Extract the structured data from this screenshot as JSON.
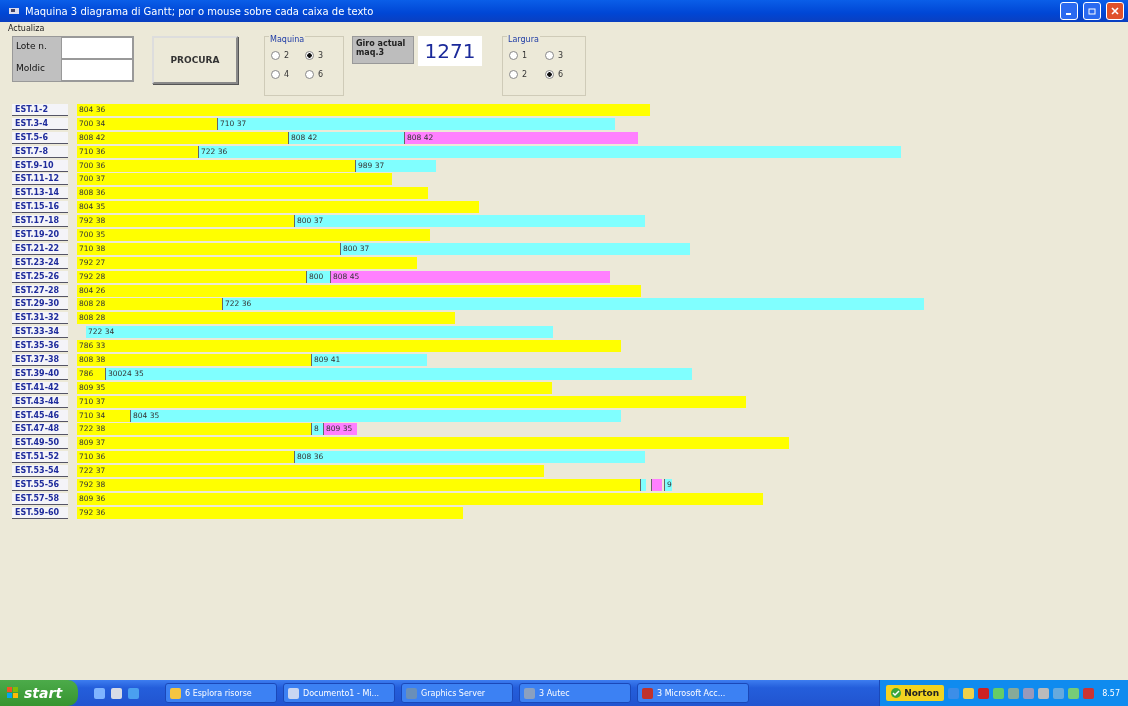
{
  "window": {
    "title": "Maquina 3 diagrama di Gantt; por o mouse sobre cada caixa de texto"
  },
  "menu": [
    "Actualiza"
  ],
  "search": {
    "fields": [
      {
        "label": "Lote n."
      },
      {
        "label": "Moldic"
      }
    ],
    "button": "PROCURA"
  },
  "machine_group": {
    "title": "Maquina",
    "options": [
      {
        "label": "2",
        "selected": false
      },
      {
        "label": "3",
        "selected": true
      },
      {
        "label": "4",
        "selected": false
      },
      {
        "label": "6",
        "selected": false
      }
    ]
  },
  "current_turn": {
    "label": "Giro actual maq.3",
    "value": "1271"
  },
  "width_group": {
    "title": "Largura",
    "options": [
      {
        "label": "1",
        "selected": false
      },
      {
        "label": "3",
        "selected": false
      },
      {
        "label": "2",
        "selected": false
      },
      {
        "label": "6",
        "selected": true
      }
    ]
  },
  "rows": [
    {
      "label": "EST.1-2",
      "segments": [
        {
          "text": "804 36",
          "color": "#ffff00"
        }
      ]
    },
    {
      "label": "EST.3-4",
      "segments": [
        {
          "text": "700 34",
          "color": "#ffff00"
        },
        {
          "text": "710 37",
          "color": "#80ffff"
        }
      ]
    },
    {
      "label": "EST.5-6",
      "segments": [
        {
          "text": "808 42",
          "color": "#ffff00"
        },
        {
          "text": "808 42",
          "color": "#80ffff"
        },
        {
          "text": "808 42",
          "color": "#ff80ff"
        }
      ]
    },
    {
      "label": "EST.7-8",
      "segments": [
        {
          "text": "710 36",
          "color": "#ffff00"
        },
        {
          "text": "722 36",
          "color": "#80ffff"
        }
      ]
    },
    {
      "label": "EST.9-10",
      "segments": [
        {
          "text": "700 36",
          "color": "#ffff00"
        },
        {
          "text": "989 37",
          "color": "#80ffff"
        }
      ]
    },
    {
      "label": "EST.11-12",
      "segments": [
        {
          "text": "700 37",
          "color": "#ffff00"
        }
      ]
    },
    {
      "label": "EST.13-14",
      "segments": [
        {
          "text": "808 36",
          "color": "#ffff00"
        }
      ]
    },
    {
      "label": "EST.15-16",
      "segments": [
        {
          "text": "804 35",
          "color": "#ffff00"
        }
      ]
    },
    {
      "label": "EST.17-18",
      "segments": [
        {
          "text": "792 38",
          "color": "#ffff00"
        },
        {
          "text": "800 37",
          "color": "#80ffff"
        }
      ]
    },
    {
      "label": "EST.19-20",
      "segments": [
        {
          "text": "700 35",
          "color": "#ffff00"
        }
      ]
    },
    {
      "label": "EST.21-22",
      "segments": [
        {
          "text": "710 38",
          "color": "#ffff00"
        },
        {
          "text": "800 37",
          "color": "#80ffff"
        }
      ]
    },
    {
      "label": "EST.23-24",
      "segments": [
        {
          "text": "792 27",
          "color": "#ffff00"
        }
      ]
    },
    {
      "label": "EST.25-26",
      "segments": [
        {
          "text": "792 28",
          "color": "#ffff00"
        },
        {
          "text": "800",
          "color": "#80ffff"
        },
        {
          "text": "808 45",
          "color": "#ff80ff"
        }
      ]
    },
    {
      "label": "EST.27-28",
      "segments": [
        {
          "text": "804 26",
          "color": "#ffff00"
        }
      ]
    },
    {
      "label": "EST.29-30",
      "segments": [
        {
          "text": "808 28",
          "color": "#ffff00"
        },
        {
          "text": "722 36",
          "color": "#80ffff"
        }
      ]
    },
    {
      "label": "EST.31-32",
      "segments": [
        {
          "text": "808 28",
          "color": "#ffff00"
        }
      ]
    },
    {
      "label": "EST.33-34",
      "segments": [
        {
          "text": "722 34",
          "color": "#80ffff"
        }
      ]
    },
    {
      "label": "EST.35-36",
      "segments": [
        {
          "text": "786 33",
          "color": "#ffff00"
        }
      ]
    },
    {
      "label": "EST.37-38",
      "segments": [
        {
          "text": "808 38",
          "color": "#ffff00"
        },
        {
          "text": "809 41",
          "color": "#80ffff"
        }
      ]
    },
    {
      "label": "EST.39-40",
      "segments": [
        {
          "text": "786",
          "color": "#ffff00"
        },
        {
          "text": "30024 35",
          "color": "#80ffff"
        }
      ]
    },
    {
      "label": "EST.41-42",
      "segments": [
        {
          "text": "809 35",
          "color": "#ffff00"
        }
      ]
    },
    {
      "label": "EST.43-44",
      "segments": [
        {
          "text": "710 37",
          "color": "#ffff00"
        }
      ]
    },
    {
      "label": "EST.45-46",
      "segments": [
        {
          "text": "710 34",
          "color": "#ffff00"
        },
        {
          "text": "804 35",
          "color": "#80ffff"
        }
      ]
    },
    {
      "label": "EST.47-48",
      "segments": [
        {
          "text": "722 38",
          "color": "#ffff00"
        },
        {
          "text": "8",
          "color": "#80ffff"
        },
        {
          "text": "809 35",
          "color": "#ff80ff"
        }
      ]
    },
    {
      "label": "EST.49-50",
      "segments": [
        {
          "text": "809 37",
          "color": "#ffff00"
        }
      ]
    },
    {
      "label": "EST.51-52",
      "segments": [
        {
          "text": "710 36",
          "color": "#ffff00"
        },
        {
          "text": "808 36",
          "color": "#80ffff"
        }
      ]
    },
    {
      "label": "EST.53-54",
      "segments": [
        {
          "text": "722 37",
          "color": "#ffff00"
        }
      ]
    },
    {
      "label": "EST.55-56",
      "segments": [
        {
          "text": "792 38",
          "color": "#ffff00"
        },
        {
          "color": "#80ffff"
        },
        {
          "color": "#ff80ff"
        },
        {
          "text": "9",
          "color": "#80ffff"
        }
      ]
    },
    {
      "label": "EST.57-58",
      "segments": [
        {
          "text": "809 36",
          "color": "#ffff00"
        }
      ]
    },
    {
      "label": "EST.59-60",
      "segments": [
        {
          "text": "792 36",
          "color": "#ffff00"
        }
      ]
    }
  ],
  "taskbar": {
    "start": "start",
    "tasks": [
      "6 Esplora risorse",
      "Documento1 - Mi...",
      "Graphics Server",
      "3 Autec",
      "3 Microsoft Acc..."
    ],
    "tray_badge": "Norton",
    "clock": "8.57"
  }
}
